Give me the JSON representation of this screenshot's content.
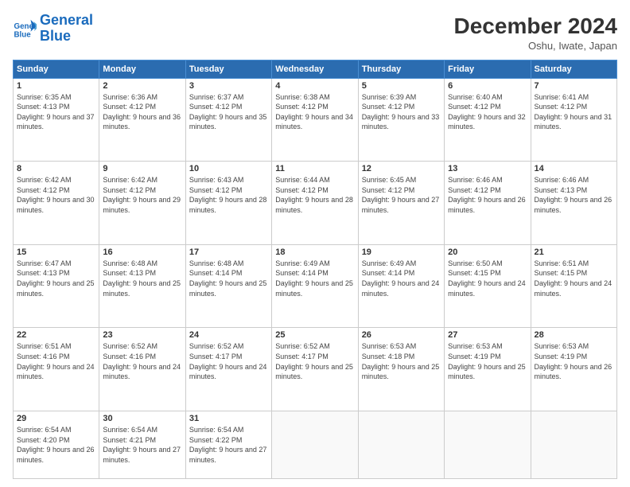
{
  "logo": {
    "line1": "General",
    "line2": "Blue"
  },
  "title": "December 2024",
  "subtitle": "Oshu, Iwate, Japan",
  "days_header": [
    "Sunday",
    "Monday",
    "Tuesday",
    "Wednesday",
    "Thursday",
    "Friday",
    "Saturday"
  ],
  "weeks": [
    [
      {
        "day": "1",
        "sunrise": "6:35 AM",
        "sunset": "4:13 PM",
        "daylight": "9 hours and 37 minutes."
      },
      {
        "day": "2",
        "sunrise": "6:36 AM",
        "sunset": "4:12 PM",
        "daylight": "9 hours and 36 minutes."
      },
      {
        "day": "3",
        "sunrise": "6:37 AM",
        "sunset": "4:12 PM",
        "daylight": "9 hours and 35 minutes."
      },
      {
        "day": "4",
        "sunrise": "6:38 AM",
        "sunset": "4:12 PM",
        "daylight": "9 hours and 34 minutes."
      },
      {
        "day": "5",
        "sunrise": "6:39 AM",
        "sunset": "4:12 PM",
        "daylight": "9 hours and 33 minutes."
      },
      {
        "day": "6",
        "sunrise": "6:40 AM",
        "sunset": "4:12 PM",
        "daylight": "9 hours and 32 minutes."
      },
      {
        "day": "7",
        "sunrise": "6:41 AM",
        "sunset": "4:12 PM",
        "daylight": "9 hours and 31 minutes."
      }
    ],
    [
      {
        "day": "8",
        "sunrise": "6:42 AM",
        "sunset": "4:12 PM",
        "daylight": "9 hours and 30 minutes."
      },
      {
        "day": "9",
        "sunrise": "6:42 AM",
        "sunset": "4:12 PM",
        "daylight": "9 hours and 29 minutes."
      },
      {
        "day": "10",
        "sunrise": "6:43 AM",
        "sunset": "4:12 PM",
        "daylight": "9 hours and 28 minutes."
      },
      {
        "day": "11",
        "sunrise": "6:44 AM",
        "sunset": "4:12 PM",
        "daylight": "9 hours and 28 minutes."
      },
      {
        "day": "12",
        "sunrise": "6:45 AM",
        "sunset": "4:12 PM",
        "daylight": "9 hours and 27 minutes."
      },
      {
        "day": "13",
        "sunrise": "6:46 AM",
        "sunset": "4:12 PM",
        "daylight": "9 hours and 26 minutes."
      },
      {
        "day": "14",
        "sunrise": "6:46 AM",
        "sunset": "4:13 PM",
        "daylight": "9 hours and 26 minutes."
      }
    ],
    [
      {
        "day": "15",
        "sunrise": "6:47 AM",
        "sunset": "4:13 PM",
        "daylight": "9 hours and 25 minutes."
      },
      {
        "day": "16",
        "sunrise": "6:48 AM",
        "sunset": "4:13 PM",
        "daylight": "9 hours and 25 minutes."
      },
      {
        "day": "17",
        "sunrise": "6:48 AM",
        "sunset": "4:14 PM",
        "daylight": "9 hours and 25 minutes."
      },
      {
        "day": "18",
        "sunrise": "6:49 AM",
        "sunset": "4:14 PM",
        "daylight": "9 hours and 25 minutes."
      },
      {
        "day": "19",
        "sunrise": "6:49 AM",
        "sunset": "4:14 PM",
        "daylight": "9 hours and 24 minutes."
      },
      {
        "day": "20",
        "sunrise": "6:50 AM",
        "sunset": "4:15 PM",
        "daylight": "9 hours and 24 minutes."
      },
      {
        "day": "21",
        "sunrise": "6:51 AM",
        "sunset": "4:15 PM",
        "daylight": "9 hours and 24 minutes."
      }
    ],
    [
      {
        "day": "22",
        "sunrise": "6:51 AM",
        "sunset": "4:16 PM",
        "daylight": "9 hours and 24 minutes."
      },
      {
        "day": "23",
        "sunrise": "6:52 AM",
        "sunset": "4:16 PM",
        "daylight": "9 hours and 24 minutes."
      },
      {
        "day": "24",
        "sunrise": "6:52 AM",
        "sunset": "4:17 PM",
        "daylight": "9 hours and 24 minutes."
      },
      {
        "day": "25",
        "sunrise": "6:52 AM",
        "sunset": "4:17 PM",
        "daylight": "9 hours and 25 minutes."
      },
      {
        "day": "26",
        "sunrise": "6:53 AM",
        "sunset": "4:18 PM",
        "daylight": "9 hours and 25 minutes."
      },
      {
        "day": "27",
        "sunrise": "6:53 AM",
        "sunset": "4:19 PM",
        "daylight": "9 hours and 25 minutes."
      },
      {
        "day": "28",
        "sunrise": "6:53 AM",
        "sunset": "4:19 PM",
        "daylight": "9 hours and 26 minutes."
      }
    ],
    [
      {
        "day": "29",
        "sunrise": "6:54 AM",
        "sunset": "4:20 PM",
        "daylight": "9 hours and 26 minutes."
      },
      {
        "day": "30",
        "sunrise": "6:54 AM",
        "sunset": "4:21 PM",
        "daylight": "9 hours and 27 minutes."
      },
      {
        "day": "31",
        "sunrise": "6:54 AM",
        "sunset": "4:22 PM",
        "daylight": "9 hours and 27 minutes."
      },
      null,
      null,
      null,
      null
    ]
  ]
}
